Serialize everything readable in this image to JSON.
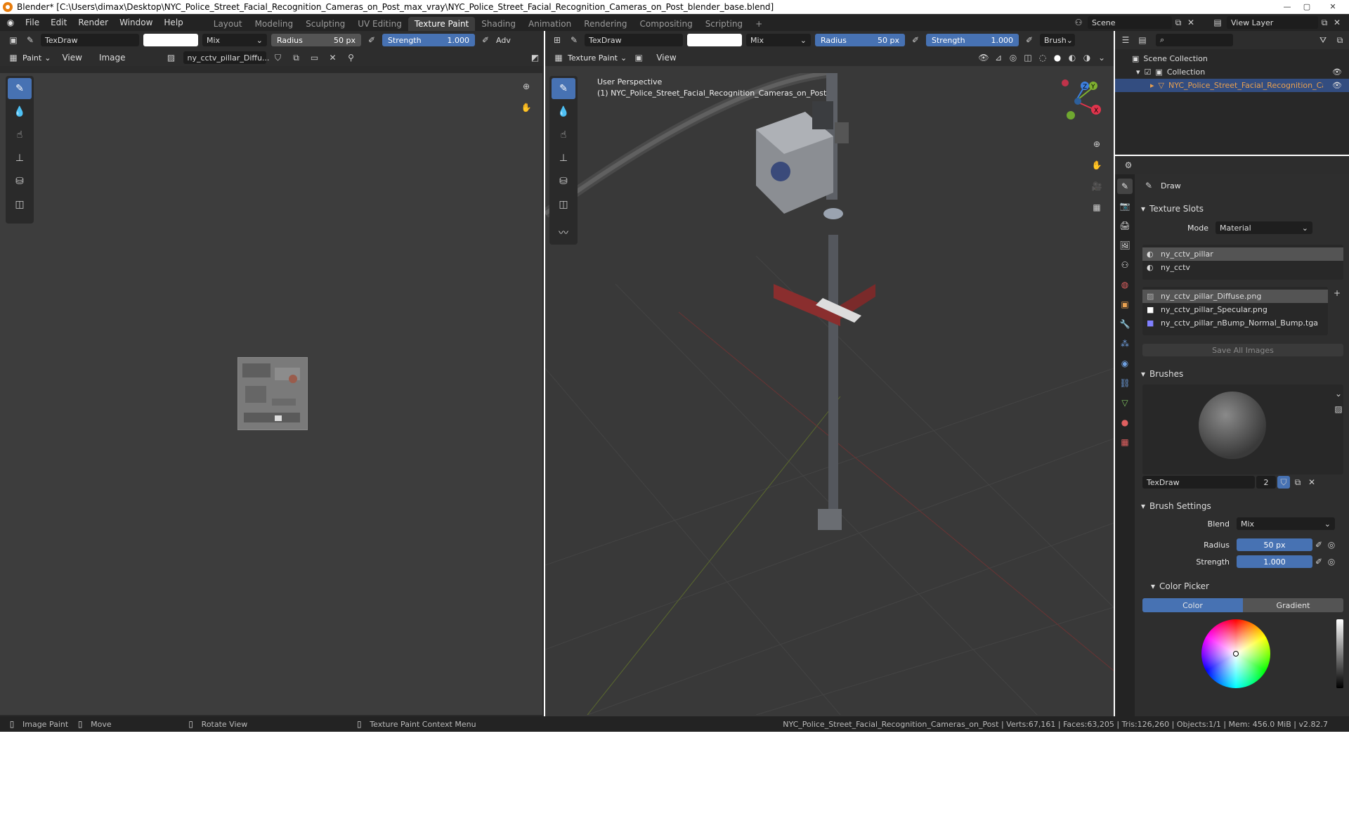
{
  "window": {
    "title": "Blender* [C:\\Users\\dimax\\Desktop\\NYC_Police_Street_Facial_Recognition_Cameras_on_Post_max_vray\\NYC_Police_Street_Facial_Recognition_Cameras_on_Post_blender_base.blend]"
  },
  "menu": [
    "File",
    "Edit",
    "Render",
    "Window",
    "Help"
  ],
  "workspaces": [
    "Layout",
    "Modeling",
    "Sculpting",
    "UV Editing",
    "Texture Paint",
    "Shading",
    "Animation",
    "Rendering",
    "Compositing",
    "Scripting"
  ],
  "active_workspace": "Texture Paint",
  "scene": {
    "name": "Scene",
    "view_layer": "View Layer"
  },
  "image_editor": {
    "brush": "TexDraw",
    "blend": "Mix",
    "radius_label": "Radius",
    "radius_value": "50 px",
    "strength_label": "Strength",
    "strength_value": "1.000",
    "adv": "Adv",
    "mode": "Paint",
    "menu": [
      "View",
      "Image"
    ],
    "image_name": "ny_cctv_pillar_Diffu..."
  },
  "viewport": {
    "brush": "TexDraw",
    "blend": "Mix",
    "radius_label": "Radius",
    "radius_value": "50 px",
    "strength_label": "Strength",
    "strength_value": "1.000",
    "brush_menu": "Brush",
    "mode": "Texture Paint",
    "menu": [
      "View"
    ],
    "perspective": "User Perspective",
    "object_label": "(1) NYC_Police_Street_Facial_Recognition_Cameras_on_Post",
    "gizmo_axes": [
      "Y",
      "Z",
      "X"
    ]
  },
  "outliner": {
    "scene_collection": "Scene Collection",
    "collection": "Collection",
    "object": "NYC_Police_Street_Facial_Recognition_Cam"
  },
  "properties": {
    "tool_name": "Draw",
    "texture_slots_title": "Texture Slots",
    "mode_label": "Mode",
    "mode_value": "Material",
    "materials": [
      "ny_cctv_pillar",
      "ny_cctv"
    ],
    "images": [
      "ny_cctv_pillar_Diffuse.png",
      "ny_cctv_pillar_Specular.png",
      "ny_cctv_pillar_nBump_Normal_Bump.tga"
    ],
    "save_all": "Save All Images",
    "brushes_title": "Brushes",
    "brush_name": "TexDraw",
    "brush_users": "2",
    "brush_settings_title": "Brush Settings",
    "blend_label": "Blend",
    "blend_value": "Mix",
    "radius_label": "Radius",
    "radius_value": "50 px",
    "strength_label": "Strength",
    "strength_value": "1.000",
    "color_picker_title": "Color Picker",
    "color_tab": "Color",
    "gradient_tab": "Gradient"
  },
  "status": {
    "items": [
      "Image Paint",
      "Move",
      "Rotate View",
      "Texture Paint Context Menu"
    ],
    "info": "NYC_Police_Street_Facial_Recognition_Cameras_on_Post | Verts:67,161 | Faces:63,205 | Tris:126,260 | Objects:1/1 | Mem: 456.0 MiB | v2.82.7"
  },
  "colors": {
    "accent": "#4772b3",
    "background": "#393939",
    "header": "#2d2d2d"
  }
}
